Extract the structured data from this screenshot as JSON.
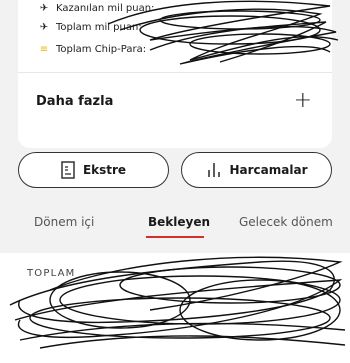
{
  "summary_card": {
    "rows": [
      {
        "icon": "plane-icon",
        "label": "Kazanılan mil puan:"
      },
      {
        "icon": "plane-icon",
        "label": "Toplam mil puan:"
      },
      {
        "icon": "chip-coin-icon",
        "label": "Toplam Chip-Para:"
      }
    ],
    "more_label": "Daha fazla"
  },
  "actions": {
    "statement_label": "Ekstre",
    "spending_label": "Harcamalar"
  },
  "tabs": [
    {
      "label": "Dönem içi",
      "active": false
    },
    {
      "label": "Bekleyen",
      "active": true
    },
    {
      "label": "Gelecek dönem",
      "active": false
    }
  ],
  "totals": {
    "heading": "TOPLAM"
  },
  "colors": {
    "accent": "#d32f2f",
    "chip": "#e9b800"
  }
}
